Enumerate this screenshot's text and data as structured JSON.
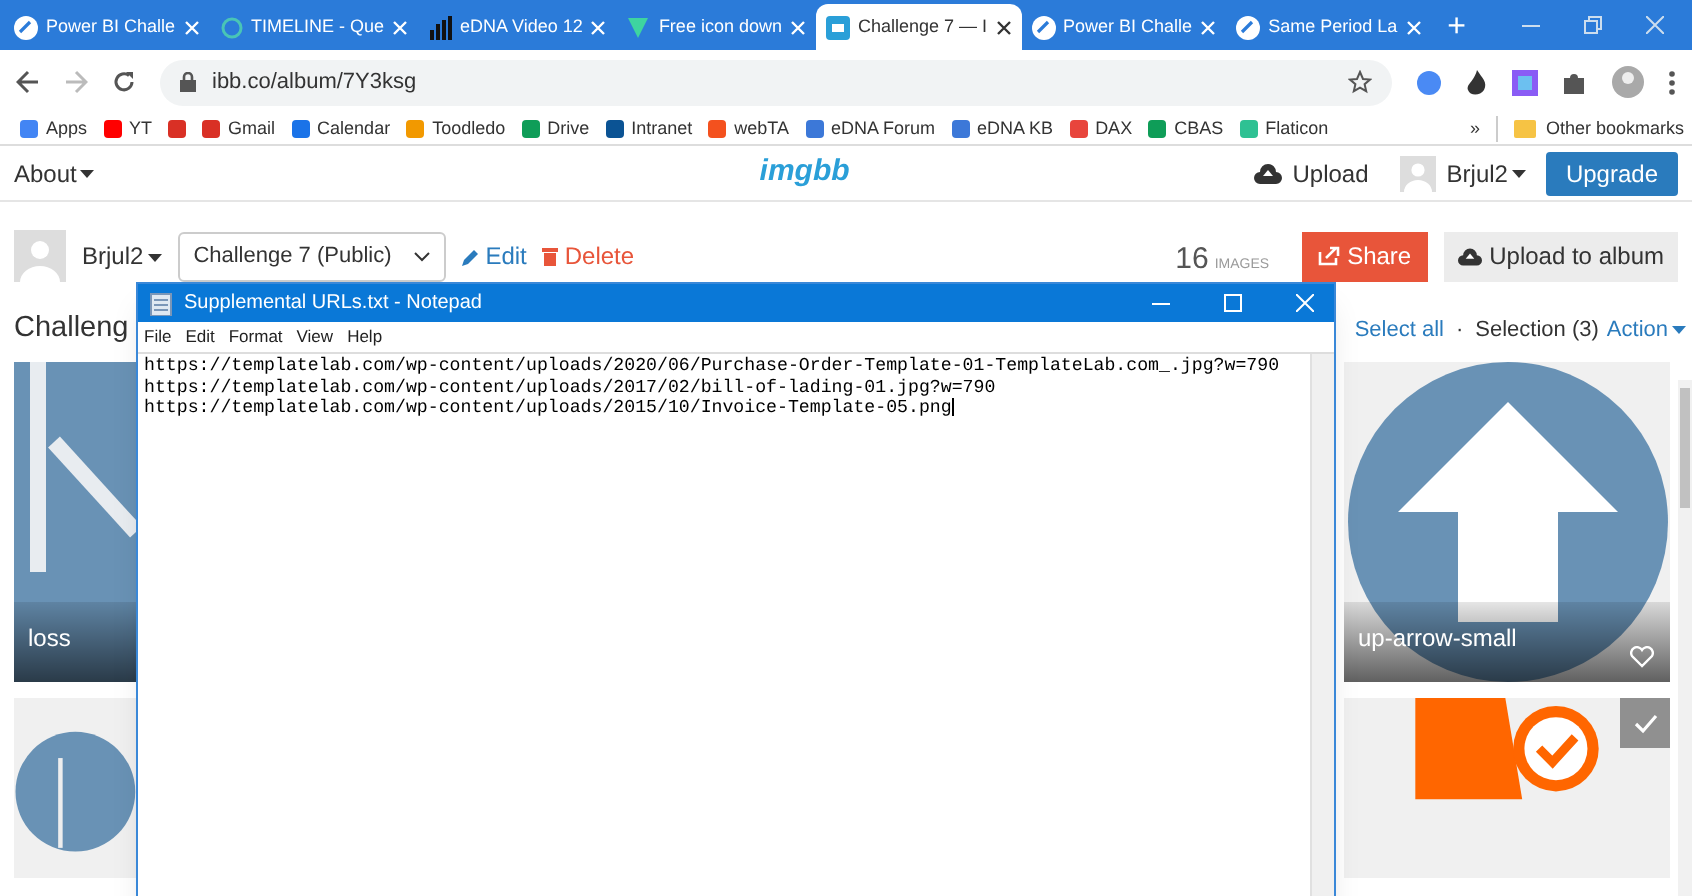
{
  "browser": {
    "tabs": [
      {
        "title": "Power BI Challe",
        "selected": false,
        "kind": "powerbi"
      },
      {
        "title": "TIMELINE - Que",
        "selected": false,
        "kind": "circle"
      },
      {
        "title": "eDNA Video 12",
        "selected": false,
        "kind": "bars"
      },
      {
        "title": "Free icon down",
        "selected": false,
        "kind": "flaticon"
      },
      {
        "title": "Challenge 7 — I",
        "selected": true,
        "kind": "ibb"
      },
      {
        "title": "Power BI Challe",
        "selected": false,
        "kind": "powerbi"
      },
      {
        "title": "Same Period La",
        "selected": false,
        "kind": "powerbi"
      }
    ],
    "new_tab": "+",
    "url": "ibb.co/album/7Y3ksg",
    "bookmarks": [
      {
        "label": "Apps",
        "color": "#4285f4"
      },
      {
        "label": "YT",
        "color": "#ff0000"
      },
      {
        "color": "#d93025"
      },
      {
        "label": "Gmail",
        "color": "#d93025"
      },
      {
        "label": "Calendar",
        "color": "#1a73e8"
      },
      {
        "label": "Toodledo",
        "color": "#f29900"
      },
      {
        "label": "Drive",
        "color": "#0f9d58"
      },
      {
        "label": "Intranet",
        "color": "#0b5394"
      },
      {
        "label": "webTA",
        "color": "#f4511e"
      },
      {
        "label": "eDNA Forum",
        "color": "#3c78d8"
      },
      {
        "label": "eDNA KB",
        "color": "#3c78d8"
      },
      {
        "label": "DAX",
        "color": "#e8453c"
      },
      {
        "label": "CBAS",
        "color": "#0f9d58"
      },
      {
        "label": "Flaticon",
        "color": "#2ec193"
      }
    ],
    "more": "»",
    "other_bookmarks": "Other bookmarks"
  },
  "site": {
    "about": "About",
    "logo": "imgbb",
    "upload": "Upload",
    "user": "Brjul2",
    "upgrade": "Upgrade"
  },
  "album": {
    "owner": "Brjul2",
    "select_value": "Challenge 7 (Public)",
    "edit": "Edit",
    "delete": "Delete",
    "count": "16",
    "count_label": "IMAGES",
    "share": "Share",
    "upload_to_album": "Upload to album",
    "title": "Challeng",
    "select_all": "Select all",
    "separator": "·",
    "selection": "Selection (3)",
    "action": "Action"
  },
  "tiles": [
    {
      "kind": "loss",
      "label": "loss"
    },
    {
      "kind": "arrow",
      "label": "up-arrow-small",
      "selected": false
    },
    {
      "kind": "circle"
    },
    {
      "kind": "cart",
      "selected": true
    }
  ],
  "notepad": {
    "title": "Supplemental URLs.txt - Notepad",
    "menu": [
      "File",
      "Edit",
      "Format",
      "View",
      "Help"
    ],
    "lines": [
      "https://templatelab.com/wp-content/uploads/2020/06/Purchase-Order-Template-01-TemplateLab.com_.jpg?w=790",
      "https://templatelab.com/wp-content/uploads/2017/02/bill-of-lading-01.jpg?w=790",
      "https://templatelab.com/wp-content/uploads/2015/10/Invoice-Template-05.png"
    ]
  }
}
